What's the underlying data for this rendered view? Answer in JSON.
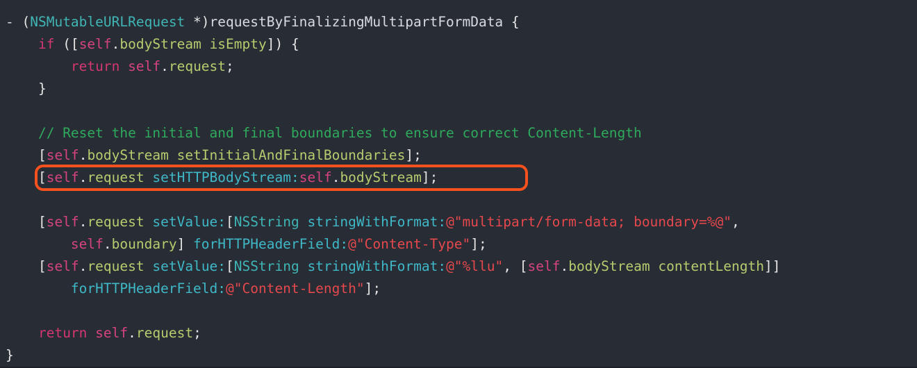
{
  "editor": {
    "language": "Objective-C",
    "background_color": "#282c34",
    "font_size_px": 19.5,
    "line_height_px": 32
  },
  "theme": {
    "plain": "#d7dae0",
    "punctuation": "#e6e6e6",
    "type": "#3fb5b5",
    "keyword": "#d3386f",
    "self": "#d6437f",
    "property": "#b6cc6e",
    "selector": "#3fb8c8",
    "string": "#e5484d",
    "comment": "#2faa5d"
  },
  "annotation": {
    "shape": "rounded-rectangle",
    "color": "#f4511e",
    "stroke_width_px": 4,
    "target_line_index": 6,
    "target_text": "[self.request setHTTPBodyStream:self.bodyStream];"
  },
  "code": {
    "plain_text": "- (NSMutableURLRequest *)requestByFinalizingMultipartFormData {\n    if ([self.bodyStream isEmpty]) {\n        return self.request;\n    }\n\n    // Reset the initial and final boundaries to ensure correct Content-Length\n    [self.bodyStream setInitialAndFinalBoundaries];\n    [self.request setHTTPBodyStream:self.bodyStream];\n\n    [self.request setValue:[NSString stringWithFormat:@\"multipart/form-data; boundary=%@\",\n        self.boundary] forHTTPHeaderField:@\"Content-Type\"];\n    [self.request setValue:[NSString stringWithFormat:@\"%llu\", [self.bodyStream contentLength]]\n        forHTTPHeaderField:@\"Content-Length\"];\n\n    return self.request;\n}",
    "lines": [
      {
        "indent": 0,
        "tokens": [
          {
            "text": "- ",
            "type": "plain"
          },
          {
            "text": "(",
            "type": "punct"
          },
          {
            "text": "NSMutableURLRequest",
            "type": "type"
          },
          {
            "text": " *)",
            "type": "punct"
          },
          {
            "text": "requestByFinalizingMultipartFormData",
            "type": "plain"
          },
          {
            "text": " {",
            "type": "punct"
          }
        ]
      },
      {
        "indent": 4,
        "tokens": [
          {
            "text": "if",
            "type": "keyword"
          },
          {
            "text": " ([",
            "type": "punct"
          },
          {
            "text": "self",
            "type": "self"
          },
          {
            "text": ".",
            "type": "punct"
          },
          {
            "text": "bodyStream",
            "type": "prop"
          },
          {
            "text": " ",
            "type": "plain"
          },
          {
            "text": "isEmpty",
            "type": "prop"
          },
          {
            "text": "]) {",
            "type": "punct"
          }
        ]
      },
      {
        "indent": 8,
        "tokens": [
          {
            "text": "return",
            "type": "keyword"
          },
          {
            "text": " ",
            "type": "plain"
          },
          {
            "text": "self",
            "type": "self"
          },
          {
            "text": ".",
            "type": "punct"
          },
          {
            "text": "request",
            "type": "prop"
          },
          {
            "text": ";",
            "type": "punct"
          }
        ]
      },
      {
        "indent": 4,
        "tokens": [
          {
            "text": "}",
            "type": "punct"
          }
        ]
      },
      {
        "indent": 0,
        "blank": true,
        "tokens": []
      },
      {
        "indent": 4,
        "tokens": [
          {
            "text": "// Reset the initial and final boundaries to ensure correct Content-Length",
            "type": "comment"
          }
        ]
      },
      {
        "indent": 4,
        "tokens": [
          {
            "text": "[",
            "type": "punct"
          },
          {
            "text": "self",
            "type": "self"
          },
          {
            "text": ".",
            "type": "punct"
          },
          {
            "text": "bodyStream",
            "type": "prop"
          },
          {
            "text": " ",
            "type": "plain"
          },
          {
            "text": "setInitialAndFinalBoundaries",
            "type": "prop"
          },
          {
            "text": "];",
            "type": "punct"
          }
        ]
      },
      {
        "indent": 4,
        "highlighted": true,
        "tokens": [
          {
            "text": "[",
            "type": "punct"
          },
          {
            "text": "self",
            "type": "self"
          },
          {
            "text": ".",
            "type": "punct"
          },
          {
            "text": "request",
            "type": "prop"
          },
          {
            "text": " ",
            "type": "plain"
          },
          {
            "text": "setHTTPBodyStream",
            "type": "selector"
          },
          {
            "text": ":",
            "type": "colon"
          },
          {
            "text": "self",
            "type": "self"
          },
          {
            "text": ".",
            "type": "punct"
          },
          {
            "text": "bodyStream",
            "type": "prop"
          },
          {
            "text": "];",
            "type": "punct"
          }
        ]
      },
      {
        "indent": 0,
        "blank": true,
        "tokens": []
      },
      {
        "indent": 4,
        "tokens": [
          {
            "text": "[",
            "type": "punct"
          },
          {
            "text": "self",
            "type": "self"
          },
          {
            "text": ".",
            "type": "punct"
          },
          {
            "text": "request",
            "type": "prop"
          },
          {
            "text": " ",
            "type": "plain"
          },
          {
            "text": "setValue",
            "type": "selector"
          },
          {
            "text": ":",
            "type": "colon"
          },
          {
            "text": "[",
            "type": "punct"
          },
          {
            "text": "NSString",
            "type": "type"
          },
          {
            "text": " ",
            "type": "plain"
          },
          {
            "text": "stringWithFormat",
            "type": "selector"
          },
          {
            "text": ":",
            "type": "colon"
          },
          {
            "text": "@\"multipart/form-data; boundary=%@\"",
            "type": "string"
          },
          {
            "text": ",",
            "type": "punct"
          }
        ]
      },
      {
        "indent": 8,
        "tokens": [
          {
            "text": "self",
            "type": "self"
          },
          {
            "text": ".",
            "type": "punct"
          },
          {
            "text": "boundary",
            "type": "prop"
          },
          {
            "text": "] ",
            "type": "punct"
          },
          {
            "text": "forHTTPHeaderField",
            "type": "selector"
          },
          {
            "text": ":",
            "type": "colon"
          },
          {
            "text": "@\"Content-Type\"",
            "type": "string"
          },
          {
            "text": "];",
            "type": "punct"
          }
        ]
      },
      {
        "indent": 4,
        "tokens": [
          {
            "text": "[",
            "type": "punct"
          },
          {
            "text": "self",
            "type": "self"
          },
          {
            "text": ".",
            "type": "punct"
          },
          {
            "text": "request",
            "type": "prop"
          },
          {
            "text": " ",
            "type": "plain"
          },
          {
            "text": "setValue",
            "type": "selector"
          },
          {
            "text": ":",
            "type": "colon"
          },
          {
            "text": "[",
            "type": "punct"
          },
          {
            "text": "NSString",
            "type": "type"
          },
          {
            "text": " ",
            "type": "plain"
          },
          {
            "text": "stringWithFormat",
            "type": "selector"
          },
          {
            "text": ":",
            "type": "colon"
          },
          {
            "text": "@\"%llu\"",
            "type": "string"
          },
          {
            "text": ", [",
            "type": "punct"
          },
          {
            "text": "self",
            "type": "self"
          },
          {
            "text": ".",
            "type": "punct"
          },
          {
            "text": "bodyStream",
            "type": "prop"
          },
          {
            "text": " ",
            "type": "plain"
          },
          {
            "text": "contentLength",
            "type": "prop"
          },
          {
            "text": "]]",
            "type": "punct"
          }
        ]
      },
      {
        "indent": 8,
        "tokens": [
          {
            "text": "forHTTPHeaderField",
            "type": "selector"
          },
          {
            "text": ":",
            "type": "colon"
          },
          {
            "text": "@\"Content-Length\"",
            "type": "string"
          },
          {
            "text": "];",
            "type": "punct"
          }
        ]
      },
      {
        "indent": 0,
        "blank": true,
        "tokens": []
      },
      {
        "indent": 4,
        "tokens": [
          {
            "text": "return",
            "type": "keyword"
          },
          {
            "text": " ",
            "type": "plain"
          },
          {
            "text": "self",
            "type": "self"
          },
          {
            "text": ".",
            "type": "punct"
          },
          {
            "text": "request",
            "type": "prop"
          },
          {
            "text": ";",
            "type": "punct"
          }
        ]
      },
      {
        "indent": 0,
        "tokens": [
          {
            "text": "}",
            "type": "punct"
          }
        ]
      }
    ]
  }
}
